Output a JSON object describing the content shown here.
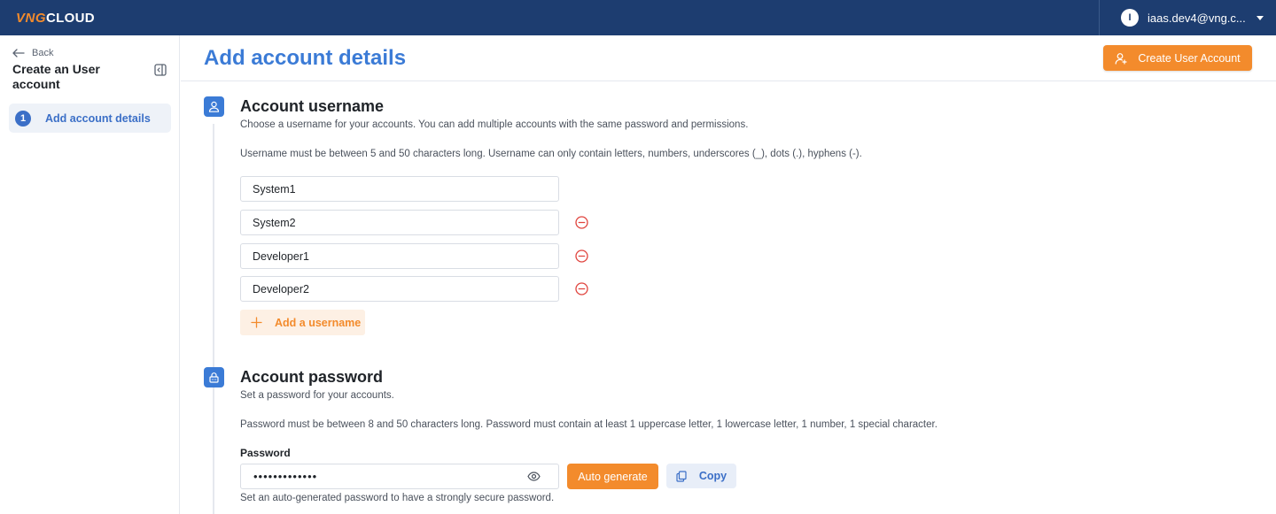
{
  "topbar": {
    "logo_vng": "VNG",
    "logo_cloud": "CLOUD",
    "user_initial": "I",
    "user_email": "iaas.dev4@vng.c..."
  },
  "sidebar": {
    "back_label": "Back",
    "title": "Create an User account",
    "steps": [
      {
        "number": "1",
        "label": "Add account details"
      }
    ]
  },
  "header": {
    "page_title": "Add account details",
    "create_button_label": "Create User Account"
  },
  "username_section": {
    "title": "Account username",
    "description": "Choose a username for your accounts. You can add multiple accounts with the same password and permissions.",
    "rules": "Username must be between 5 and 50 characters long. Username can only contain letters, numbers, underscores (_), dots (.), hyphens (-).",
    "usernames": [
      "System1",
      "System2",
      "Developer1",
      "Developer2"
    ],
    "add_button_label": "Add a username"
  },
  "password_section": {
    "title": "Account password",
    "description": "Set a password for your accounts.",
    "rules": "Password must be between 8 and 50 characters long. Password must contain at least 1 uppercase letter, 1 lowercase letter, 1 number, 1 special character.",
    "field_label": "Password",
    "masked_value": "•••••••••••••",
    "auto_generate_label": "Auto generate",
    "copy_label": "Copy",
    "hint": "Set an auto-generated password to have a strongly secure password."
  },
  "colors": {
    "topbar": "#1d3d70",
    "accent_orange": "#f38b2c",
    "accent_blue": "#3b7bd6",
    "danger": "#e0443e"
  }
}
